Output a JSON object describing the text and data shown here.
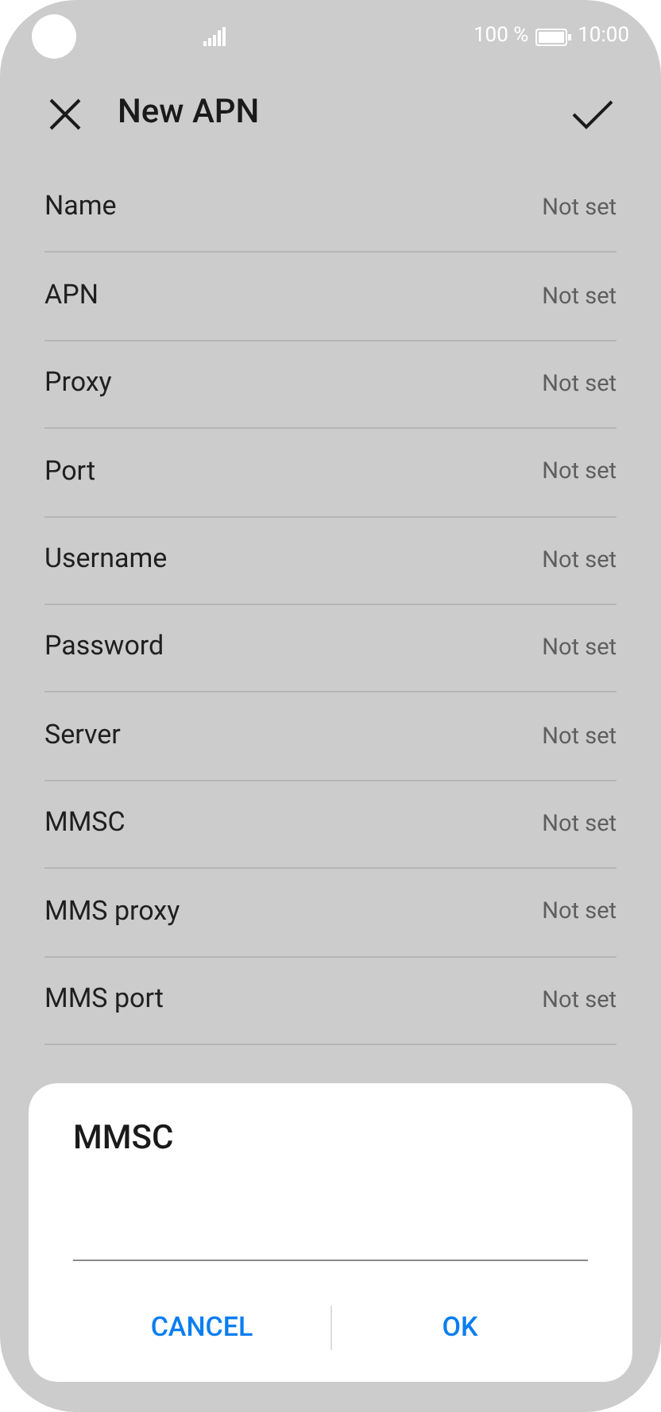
{
  "status_bar": {
    "battery_text": "100 %",
    "time": "10:00"
  },
  "header": {
    "title": "New APN"
  },
  "fields": [
    {
      "label": "Name",
      "value": "Not set"
    },
    {
      "label": "APN",
      "value": "Not set"
    },
    {
      "label": "Proxy",
      "value": "Not set"
    },
    {
      "label": "Port",
      "value": "Not set"
    },
    {
      "label": "Username",
      "value": "Not set"
    },
    {
      "label": "Password",
      "value": "Not set"
    },
    {
      "label": "Server",
      "value": "Not set"
    },
    {
      "label": "MMSC",
      "value": "Not set"
    },
    {
      "label": "MMS proxy",
      "value": "Not set"
    },
    {
      "label": "MMS port",
      "value": "Not set"
    }
  ],
  "dialog": {
    "title": "MMSC",
    "buttons": [
      "CANCEL",
      "OK"
    ]
  }
}
